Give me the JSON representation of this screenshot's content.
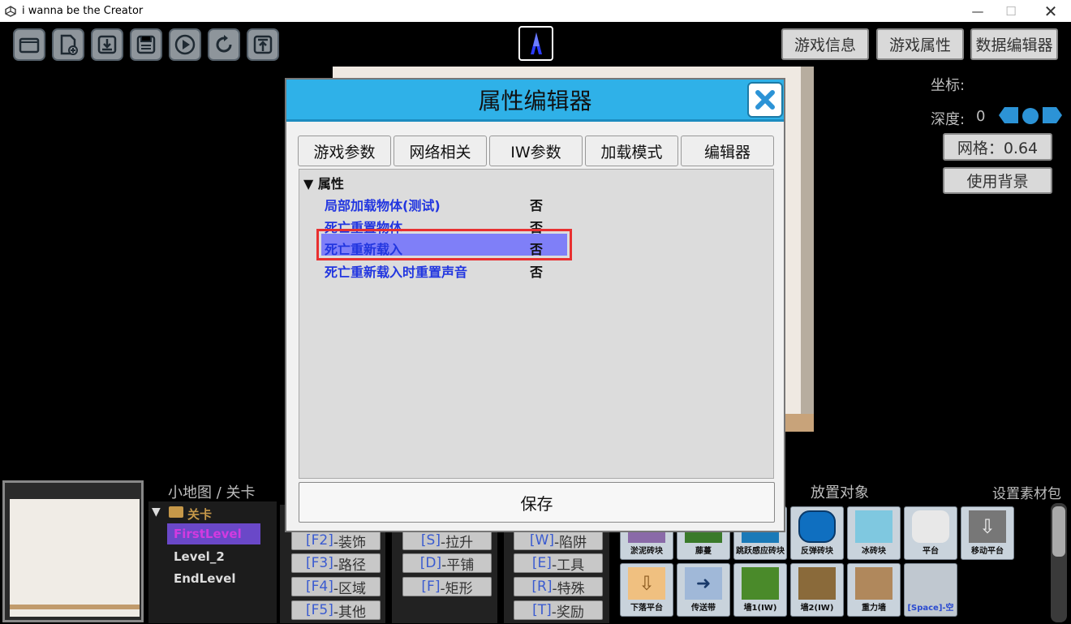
{
  "window": {
    "title": "i wanna be the Creator"
  },
  "toolbar": {
    "buttons": [
      "open",
      "new-file",
      "import",
      "save",
      "play",
      "refresh",
      "export"
    ]
  },
  "top_right": {
    "game_info": "游戏信息",
    "game_props": "游戏属性",
    "data_editor": "数据编辑器"
  },
  "info": {
    "coords_label": "坐标:",
    "depth_label": "深度:",
    "depth_value": "0",
    "grid": "网格：0.64",
    "use_background": "使用背景"
  },
  "dialog": {
    "title": "属性编辑器",
    "tabs": [
      "游戏参数",
      "网络相关",
      "IW参数",
      "加载模式",
      "编辑器"
    ],
    "section": "▼ 属性",
    "properties": [
      {
        "name": "局部加载物体(测试)",
        "value": "否"
      },
      {
        "name": "死亡重置物体",
        "value": "否"
      },
      {
        "name": "死亡重新载入",
        "value": "否"
      },
      {
        "name": "死亡重新载入时重置声音",
        "value": "否"
      }
    ],
    "save": "保存"
  },
  "bottom": {
    "minimap_label": "小地图 / 关卡",
    "place_label": "放置对象",
    "assets_label": "设置素材包",
    "levels_folder": "关卡",
    "levels": [
      "FirstLevel",
      "Level_2",
      "EndLevel"
    ],
    "categories": [
      [
        {
          "key": "[F2]",
          "text": "-装饰"
        },
        {
          "key": "[F3]",
          "text": "-路径"
        },
        {
          "key": "[F4]",
          "text": "-区域"
        },
        {
          "key": "[F5]",
          "text": "-其他"
        }
      ],
      [
        {
          "key": "[S]",
          "text": "-拉升"
        },
        {
          "key": "[D]",
          "text": "-平铺"
        },
        {
          "key": "[F]",
          "text": "-矩形"
        }
      ],
      [
        {
          "key": "[W]",
          "text": "-陷阱"
        },
        {
          "key": "[E]",
          "text": "-工具"
        },
        {
          "key": "[R]",
          "text": "-特殊"
        },
        {
          "key": "[T]",
          "text": "-奖励"
        }
      ]
    ],
    "objects_row1": [
      "淤泥砖块",
      "藤蔓",
      "跳跃感应砖块",
      "反弹砖块",
      "冰砖块",
      "平台",
      "移动平台"
    ],
    "objects_row2": [
      "下落平台",
      "传送带",
      "墙1(IW)",
      "墙2(IW)",
      "重力墙",
      "[Space]-空"
    ]
  },
  "colors": {
    "dialog_header": "#2fb1e8",
    "highlight_row": "#7f7ff8",
    "highlight_border": "#e83030",
    "prop_text": "#2236e0",
    "selected_level": "#6a48c8"
  }
}
